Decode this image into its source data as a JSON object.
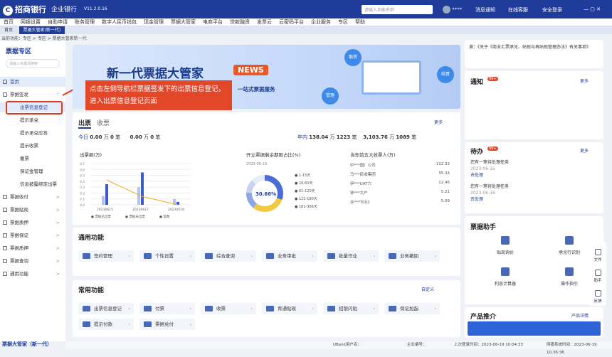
{
  "app": {
    "logo": "招商银行",
    "company": "企业银行",
    "version": "V11.2.0.16",
    "search_placeholder": "请输入功能名称",
    "notice": "消息通知",
    "help": "在线客服",
    "logout": "安全登录"
  },
  "nav": [
    "首页",
    "网银设置",
    "自助申请",
    "账务管理",
    "数字人民币钱包",
    "现金管理",
    "票据大管家",
    "电商平台",
    "贷款融资",
    "发票云",
    "云密码平台",
    "企业服务",
    "专区",
    "帮助"
  ],
  "tabs": [
    "首页",
    "票据大管家(新一代)"
  ],
  "crumb": "当前功能：专区 > 专区 > 票据大管家新一代",
  "side": {
    "title": "票据专区",
    "search": "请输入关键词搜索",
    "items": [
      {
        "label": "首页",
        "hl": true
      },
      {
        "label": "票据签发",
        "ch": "^"
      },
      {
        "label": "出票信息登记",
        "sub": true,
        "hl": true
      },
      {
        "label": "提示承兑",
        "sub": true
      },
      {
        "label": "提示承兑应答",
        "sub": true
      },
      {
        "label": "提示收票",
        "sub": true
      },
      {
        "label": "撤票",
        "sub": true
      },
      {
        "label": "保证金管理",
        "sub": true
      },
      {
        "label": "信息披露绑定出票",
        "sub": true
      },
      {
        "label": "票据收付",
        "ch": ">"
      },
      {
        "label": "票据贴现",
        "ch": ">"
      },
      {
        "label": "票据质押",
        "ch": ">"
      },
      {
        "label": "票据保证",
        "ch": ">"
      },
      {
        "label": "票据质押",
        "ch": ">"
      },
      {
        "label": "票据查询",
        "ch": ">"
      },
      {
        "label": "通用功能",
        "ch": ">"
      }
    ],
    "bottom": "票据大管家（新一代）"
  },
  "callout": "点击左侧导航栏票据签发下的出票信息登记，进入出票信息登记页面",
  "banner": {
    "title": "新一代票据大管家",
    "news": "NEWS",
    "sub": "一站式票据服务",
    "b1": "融资",
    "b2": "结算",
    "b3": "管理"
  },
  "bill": {
    "tab1": "出票",
    "tab2": "收票",
    "more": "更多",
    "today": {
      "label": "今日",
      "a": "0.00",
      "a_unit": "万",
      "b": "0",
      "b_unit": "笔",
      "c": "0.00",
      "c_unit": "万",
      "d": "0",
      "d_unit": "笔"
    },
    "year": {
      "label": "年内",
      "a": "138.04",
      "a_unit": "万",
      "b": "1223",
      "b_unit": "笔",
      "c": "3,103.76",
      "c_unit": "万",
      "d": "1089",
      "d_unit": "笔"
    }
  },
  "colors": {
    "primary": "#1f3c9a",
    "accent": "#e3472a",
    "orange": "#f5a623"
  },
  "chart_data": [
    {
      "type": "bar",
      "title": "出票额(万)",
      "categories": [
        "20230615",
        "20230617",
        "20230619"
      ],
      "ylim_left": [
        0,
        0.7
      ],
      "ylim_right": [
        0,
        15
      ],
      "series": [
        {
          "name": "票据已出票",
          "values": [
            0.35,
            0.55,
            0.05
          ]
        },
        {
          "name": "票据未出票",
          "values": [
            0.15,
            0.3,
            0.1
          ]
        },
        {
          "name": "笔数",
          "values": [
            9,
            3,
            0
          ]
        }
      ]
    },
    {
      "type": "pie",
      "title": "开立票据剩余期限占比(%)",
      "date": "2023-06-19",
      "center": "30.66%",
      "labels": [
        "1-15天",
        "16-60天",
        "61-120天",
        "121-180天",
        "181-366天"
      ],
      "values": [
        30.66,
        30,
        15,
        12,
        12.34
      ]
    },
    {
      "type": "table",
      "title": "当年前五大收票人(万)",
      "rows": [
        [
          "中***国）公司",
          "112.32"
        ],
        [
          "马***民收集团",
          "35.34"
        ],
        [
          "伊***UAT六",
          "12.46"
        ],
        [
          "钟***大户",
          "5.21"
        ],
        [
          "众***T002",
          "5.09"
        ]
      ]
    }
  ],
  "common": {
    "title": "通用功能",
    "items": [
      "签约管理",
      "个性设置",
      "综合查询",
      "业务审批",
      "批量作业",
      "业务撤回"
    ]
  },
  "frequent": {
    "title": "常用功能",
    "custom": "自定义",
    "items": [
      "出票信息登记",
      "付票",
      "收票",
      "背通贴现",
      "招银闪贴",
      "保证加起",
      "提示付款",
      "票据兑付"
    ]
  },
  "right": {
    "note": "谢：《关于《商业汇票承兑、贴现与再贴现管理办法》有关事项》",
    "notice": "通知",
    "notice_badge": "99+",
    "more": "更多",
    "todo": "待办",
    "todo_badge": "99+",
    "todos": [
      {
        "t": "您有一笔待处理任务",
        "d": "2023-06-16",
        "go": "去处理"
      },
      {
        "t": "您有一笔待处理任务",
        "d": "2023-06-16",
        "go": "去处理"
      }
    ],
    "helper": "票据助手",
    "tools": [
      "贴现询价",
      "承兑行识别",
      "利息计算器",
      "操作指引"
    ],
    "product": "产品推介",
    "product_more": "产品详情"
  },
  "rtool": [
    "文件",
    "助手",
    "反馈"
  ],
  "status": {
    "user": "UBank用户名：",
    "company": "企业编号：",
    "last": "上次登录时间：2023-06-19 10:04:33",
    "sys": "网银系统时间：2023-06-19 10:36:36"
  }
}
